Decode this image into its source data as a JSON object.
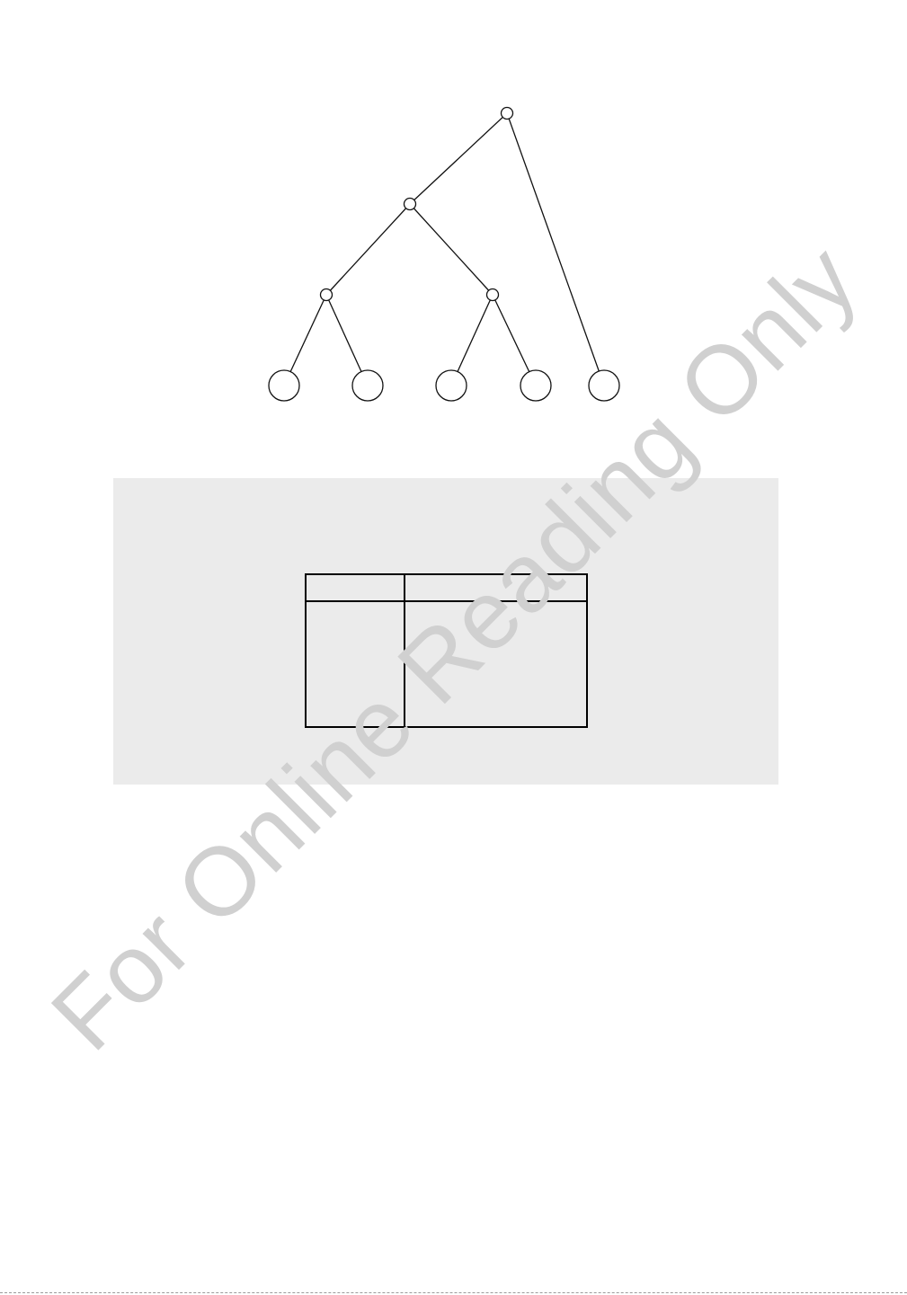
{
  "diagram": {
    "type": "binary-tree",
    "internal_node_count": 4,
    "leaf_count": 5,
    "node_labels": []
  },
  "table": {
    "columns": 2,
    "header": [
      "",
      ""
    ],
    "rows": []
  },
  "watermark": {
    "text": "For Online Reading Only"
  },
  "colors": {
    "panel_background": "#ebebeb",
    "watermark": "#d0d0d0",
    "stroke": "#111111"
  }
}
